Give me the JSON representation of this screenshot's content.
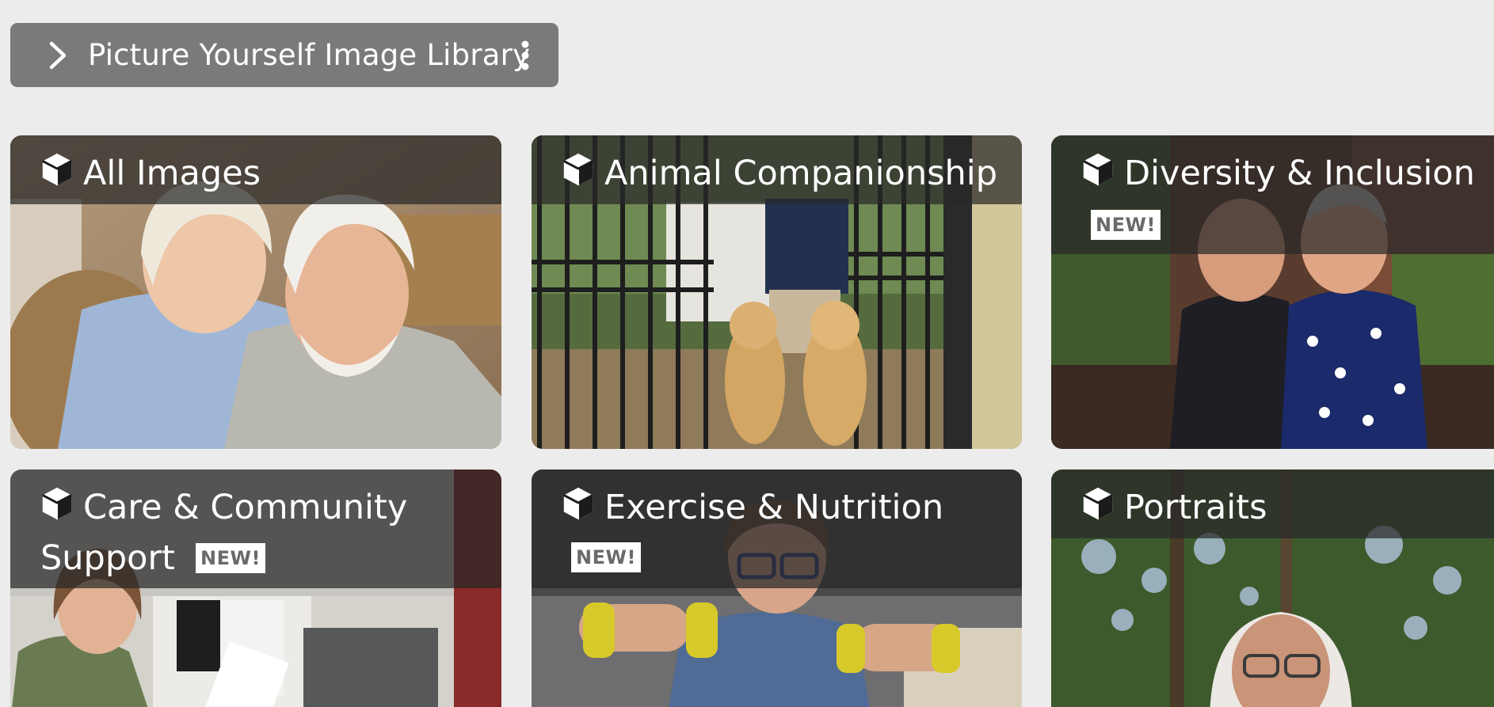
{
  "breadcrumb": {
    "label": "Picture Yourself Image Library",
    "chevron_icon": "chevron-right-icon",
    "menu_icon": "more-vertical-icon"
  },
  "tiles": [
    {
      "title": "All Images",
      "icon": "cube-icon",
      "new": false,
      "photo": "older couple smiling in wicker chair"
    },
    {
      "title": "Animal Companionship",
      "icon": "cube-icon",
      "new": false,
      "photo": "two golden retrievers at a gate"
    },
    {
      "title": "Diversity & Inclusion",
      "icon": "cube-icon",
      "new": true,
      "badge": "NEW!",
      "photo": "two smiling men embracing"
    },
    {
      "title_line1": "Care & Community",
      "title_line2": "Support",
      "icon": "cube-icon",
      "new": true,
      "badge": "NEW!",
      "photo": "nurse writing at a reception desk"
    },
    {
      "title": "Exercise & Nutrition",
      "icon": "cube-icon",
      "new": true,
      "badge": "NEW!",
      "photo": "woman lifting yellow dumbbells"
    },
    {
      "title": "Portraits",
      "icon": "cube-icon",
      "new": false,
      "photo": "woman with white hair in a forest"
    }
  ],
  "colors": {
    "page_bg": "#ececec",
    "breadcrumb_bg": "#7a7a7a",
    "band": "rgba(40,40,40,0.72)",
    "badge_text": "#6a6a6a"
  }
}
